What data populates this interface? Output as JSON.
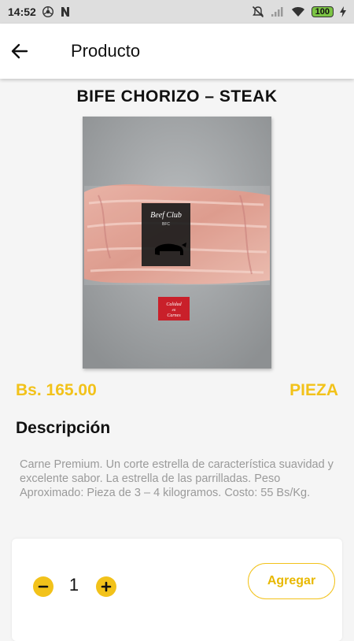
{
  "status_bar": {
    "time": "14:52",
    "battery": "100",
    "icons": [
      "chrome-icon",
      "n-icon",
      "mute-icon",
      "signal-icon",
      "wifi-icon",
      "battery-icon",
      "charging-icon"
    ]
  },
  "header": {
    "title": "Producto",
    "back_icon": "arrow-back-icon"
  },
  "product": {
    "name": "BIFE CHORIZO – STEAK",
    "price": "Bs. 165.00",
    "unit": "PIEZA",
    "image_label": {
      "brand_line1": "Beef Club",
      "brand_line2": "BFC",
      "sticker": [
        "Calidad",
        "en",
        "Carnes"
      ]
    }
  },
  "description": {
    "heading": "Descripción",
    "text": "Carne Premium. Un corte estrella de característica suavidad y excelente sabor. La estrella de las parrilladas. Peso Aproximado:  Pieza de 3 – 4 kilogramos.    Costo: 55 Bs/Kg."
  },
  "cart": {
    "quantity": "1",
    "add_label": "Agregar"
  },
  "colors": {
    "accent": "#f2c21a",
    "text_primary": "#111111",
    "text_secondary": "#9a9a9a",
    "status_bar_bg": "#dedede"
  }
}
